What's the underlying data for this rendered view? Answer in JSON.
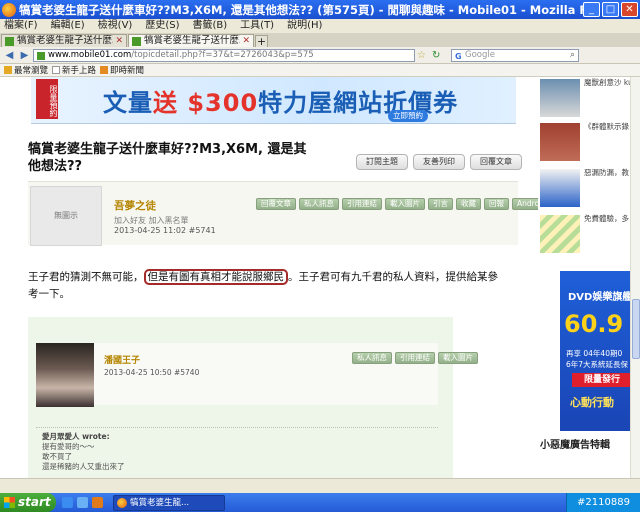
{
  "window": {
    "title": "犒賞老婆生龍子送什麼車好??M3,X6M, 還是其他想法?? (第575頁) - 閒聊與趣味 - Mobile01 - Mozilla Firefox",
    "min": "_",
    "max": "□",
    "close": "✕"
  },
  "menu": {
    "items": [
      "檔案(F)",
      "編輯(E)",
      "檢視(V)",
      "歷史(S)",
      "書籤(B)",
      "工具(T)",
      "說明(H)"
    ]
  },
  "tabs": {
    "items": [
      {
        "label": "犒賞老婆生龍子送什麼車好..."
      },
      {
        "label": "犒賞老婆生龍子送什麼車好..."
      }
    ],
    "new": "+"
  },
  "nav": {
    "back": "◀",
    "forward": "▶",
    "url_domain": "www.mobile01.com",
    "url_rest": "/topicdetail.php?f=37&t=2726043&p=575",
    "star": "☆",
    "reload": "↻",
    "search_placeholder": "Google",
    "search_g": "G",
    "search_mag": "⌕"
  },
  "bookmarks": {
    "items": [
      "最常瀏覽",
      "新手上路",
      "即時新聞"
    ]
  },
  "banner": {
    "tag": "限量預約",
    "main_a": "文量",
    "main_b": "送",
    "main_c": "$300",
    "main_d": "特力屋網站折價券",
    "btn": "立即預約"
  },
  "topic": {
    "title": "犒賞老婆生龍子送什麼車好??M3,X6M, 還是其他想法??",
    "buttons": [
      "訂閱主題",
      "友善列印",
      "回覆文章"
    ]
  },
  "post": {
    "noimg": "無圖示",
    "user": "吾夢之徒",
    "links": "加入好友  加入黑名單",
    "date": "2013-04-25 11:02  #5741",
    "buttons": [
      "回覆文章",
      "私人訊息",
      "引用連結",
      "載入圖片",
      "引言",
      "收藏",
      "回報",
      "Android"
    ],
    "body_a": "王子君的猜測不無可能，",
    "body_hl": "但是有圖有真相才能說服鄉民",
    "body_b": "。王子君可有九千君的私人資料，提供給某參考一下。"
  },
  "quote": {
    "name": "潘國王子",
    "date": "2013-04-25 10:50  #5740",
    "buttons": [
      "私人訊息",
      "引用連結",
      "載入圖片"
    ],
    "who": "愛月眾愛人 wrote:",
    "lines": [
      "提有愛哥的～～",
      "敢不買了",
      "還是稀豬的人又重出來了"
    ]
  },
  "sidebar": {
    "items": [
      {
        "text": "魔獸創意沙 kuso 暗黑看"
      },
      {
        "text": "《群體默示錄 先生珍 Jim 驚奇的國度看"
      },
      {
        "text": "惡漏防漏，教 利信瓶漏 1 元 果長達五年"
      },
      {
        "text": "免費體驗，多 量送 $300 特 網站折價券"
      }
    ],
    "dvd_title": "DVD娛樂旗艦",
    "dvd_price": "60.9",
    "dvd_line1": "再享 04年40期0",
    "dvd_line2": "6年7大系統延長保",
    "dvd_tag": "限量發行",
    "dvd_action": "心動行動",
    "link": "小惡魔廣告特輯"
  },
  "taskbar": {
    "start": "start",
    "item": "犒賞老婆生龍...",
    "tray": "#2110889"
  }
}
